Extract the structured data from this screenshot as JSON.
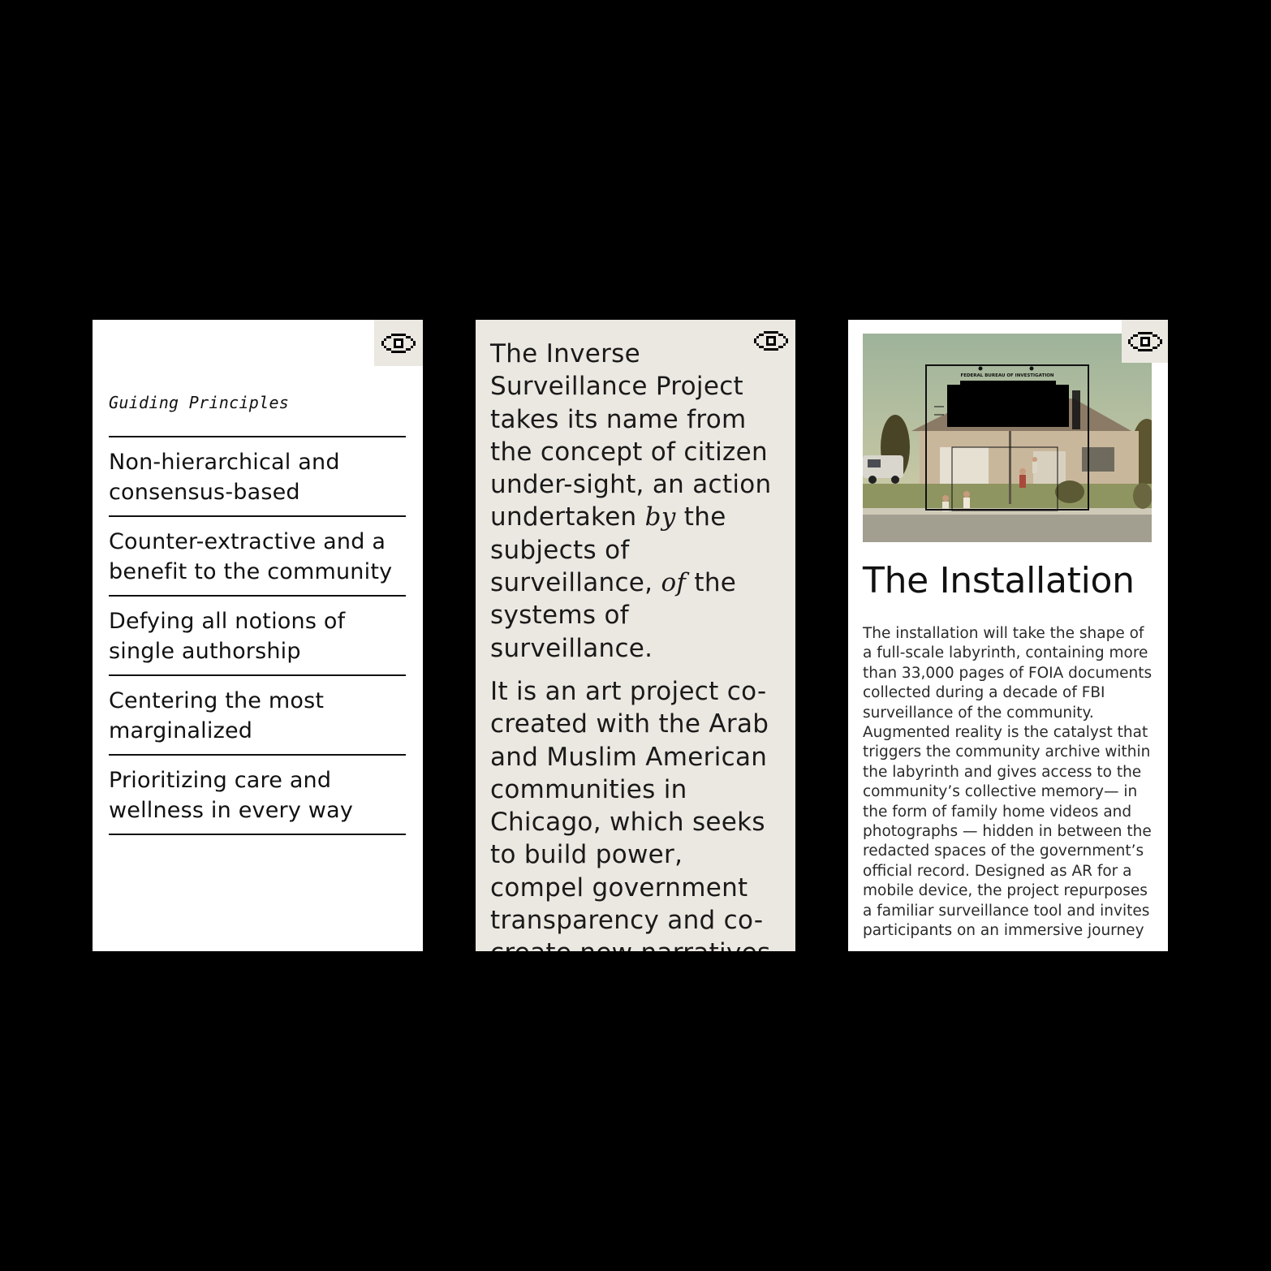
{
  "screen1": {
    "heading": "Guiding Principles",
    "principles": [
      "Non-hierarchical and consensus-based",
      "Counter-extractive and a benefit to the community",
      "Defying all notions of single authorship",
      "Centering the most marginalized",
      "Prioritizing care and wellness in every way"
    ],
    "icon": "eye-icon"
  },
  "screen2": {
    "p1_a": "The Inverse Surveillance Project takes its name from the concept of citizen under-sight, an action undertaken ",
    "p1_by": "by",
    "p1_b": " the subjects of surveillance, ",
    "p1_of": "of",
    "p1_c": " the systems of surveillance.",
    "p2": "It is an art project co-created with the Arab and Muslim American communities in Chicago, which seeks to build power, compel government transparency and co-create new narratives",
    "icon": "eye-icon"
  },
  "screen3": {
    "document_header": "FEDERAL BUREAU OF INVESTIGATION",
    "title": "The Installation",
    "body": "The installation will take the shape of a full-scale labyrinth, containing more than 33,000 pages of FOIA documents collected during a decade of FBI surveillance of the community. Augmented reality is the catalyst that triggers the community archive within the labyrinth and gives access to the community’s collective memory— in the form of family home videos and photographs — hidden in between the redacted spaces of the government’s official record. Designed as AR for a mobile device, the project repurposes a familiar surveillance tool and invites participants on an immersive journey",
    "icon": "eye-icon"
  },
  "colors": {
    "background": "#000000",
    "panel_white": "#ffffff",
    "panel_beige": "#ebe8e1",
    "text": "#111111"
  }
}
